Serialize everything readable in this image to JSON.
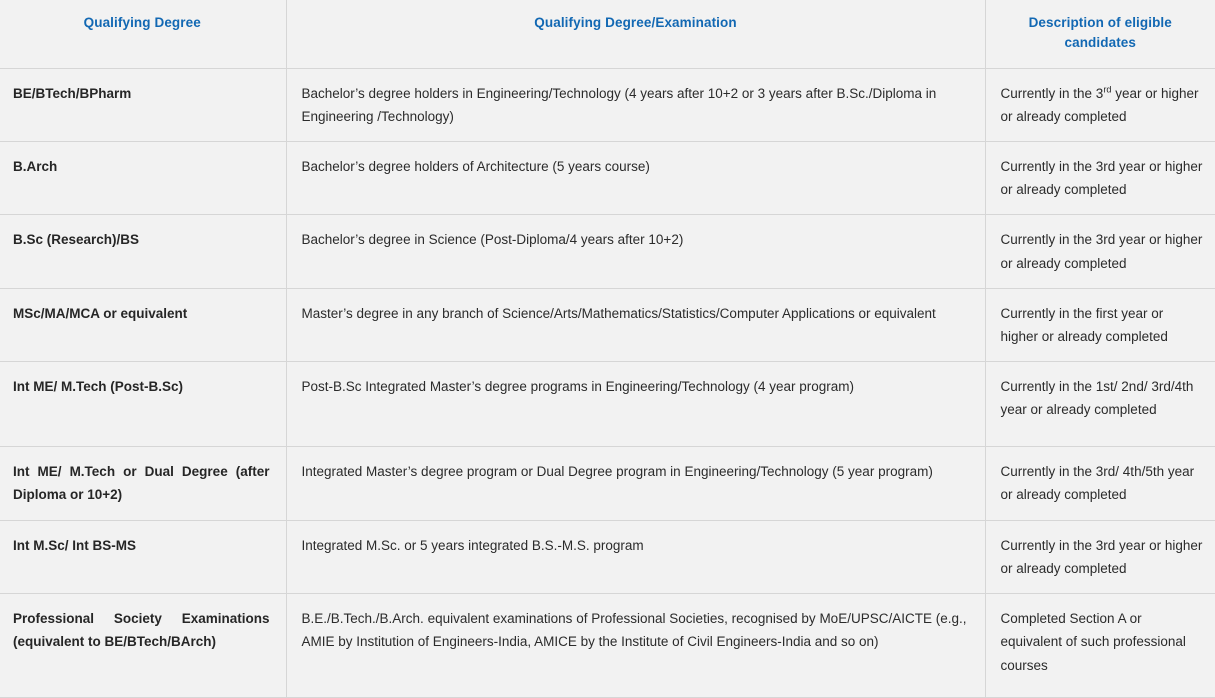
{
  "table": {
    "headers": [
      "Qualifying Degree",
      "Qualifying Degree/Examination",
      "Description of eligible candidates"
    ],
    "rows": [
      {
        "degree": "BE/BTech/BPharm",
        "examination": "Bachelor’s degree holders in Engineering/Technology (4 years after 10+2 or 3 years after B.Sc./Diploma in Engineering /Technology)",
        "description_prefix": "Currently in the 3",
        "description_sup": "rd",
        "description_suffix": " year or higher or already completed",
        "description": "Currently in the 3rd year or higher or already completed"
      },
      {
        "degree": "B.Arch",
        "examination": "Bachelor’s degree holders of Architecture (5 years course)",
        "description": "Currently in the 3rd year or higher or already completed"
      },
      {
        "degree": "B.Sc (Research)/BS",
        "examination": "Bachelor’s degree in Science (Post-Diploma/4 years after 10+2)",
        "description": "Currently in the 3rd year or higher or already completed"
      },
      {
        "degree": "MSc/MA/MCA or equivalent",
        "examination": "Master’s degree in any branch of Science/Arts/Mathematics/Statistics/Computer Applications or equivalent",
        "description": "Currently in the first year or higher or already completed"
      },
      {
        "degree": "Int ME/ M.Tech (Post-B.Sc)",
        "examination": "Post-B.Sc Integrated Master’s degree programs in Engineering/Technology (4 year program)",
        "description": "Currently in the 1st/ 2nd/ 3rd/4th year or already completed"
      },
      {
        "degree": "Int ME/ M.Tech or Dual Degree (after Diploma or 10+2)",
        "examination": "Integrated Master’s degree program or Dual Degree program in Engineering/Technology (5 year program)",
        "description": "Currently in the 3rd/ 4th/5th year or already completed"
      },
      {
        "degree": "Int M.Sc/ Int BS-MS",
        "examination": "Integrated M.Sc. or 5 years integrated B.S.-M.S. program",
        "description": "Currently in the 3rd year or higher or already completed"
      },
      {
        "degree": "Professional Society Examinations (equivalent to BE/BTech/BArch)",
        "examination": "B.E./B.Tech./B.Arch. equivalent examinations of Professional Societies, recognised by MoE/UPSC/AICTE (e.g., AMIE by Institution of Engineers-India, AMICE by the Institute of Civil Engineers-India and so on)",
        "description": "Completed Section A or equivalent of such professional courses"
      }
    ]
  },
  "colors": {
    "header_text": "#1268b3",
    "body_text": "#2b2b2b",
    "background": "#f2f2f2",
    "border": "#d6d6d6"
  }
}
